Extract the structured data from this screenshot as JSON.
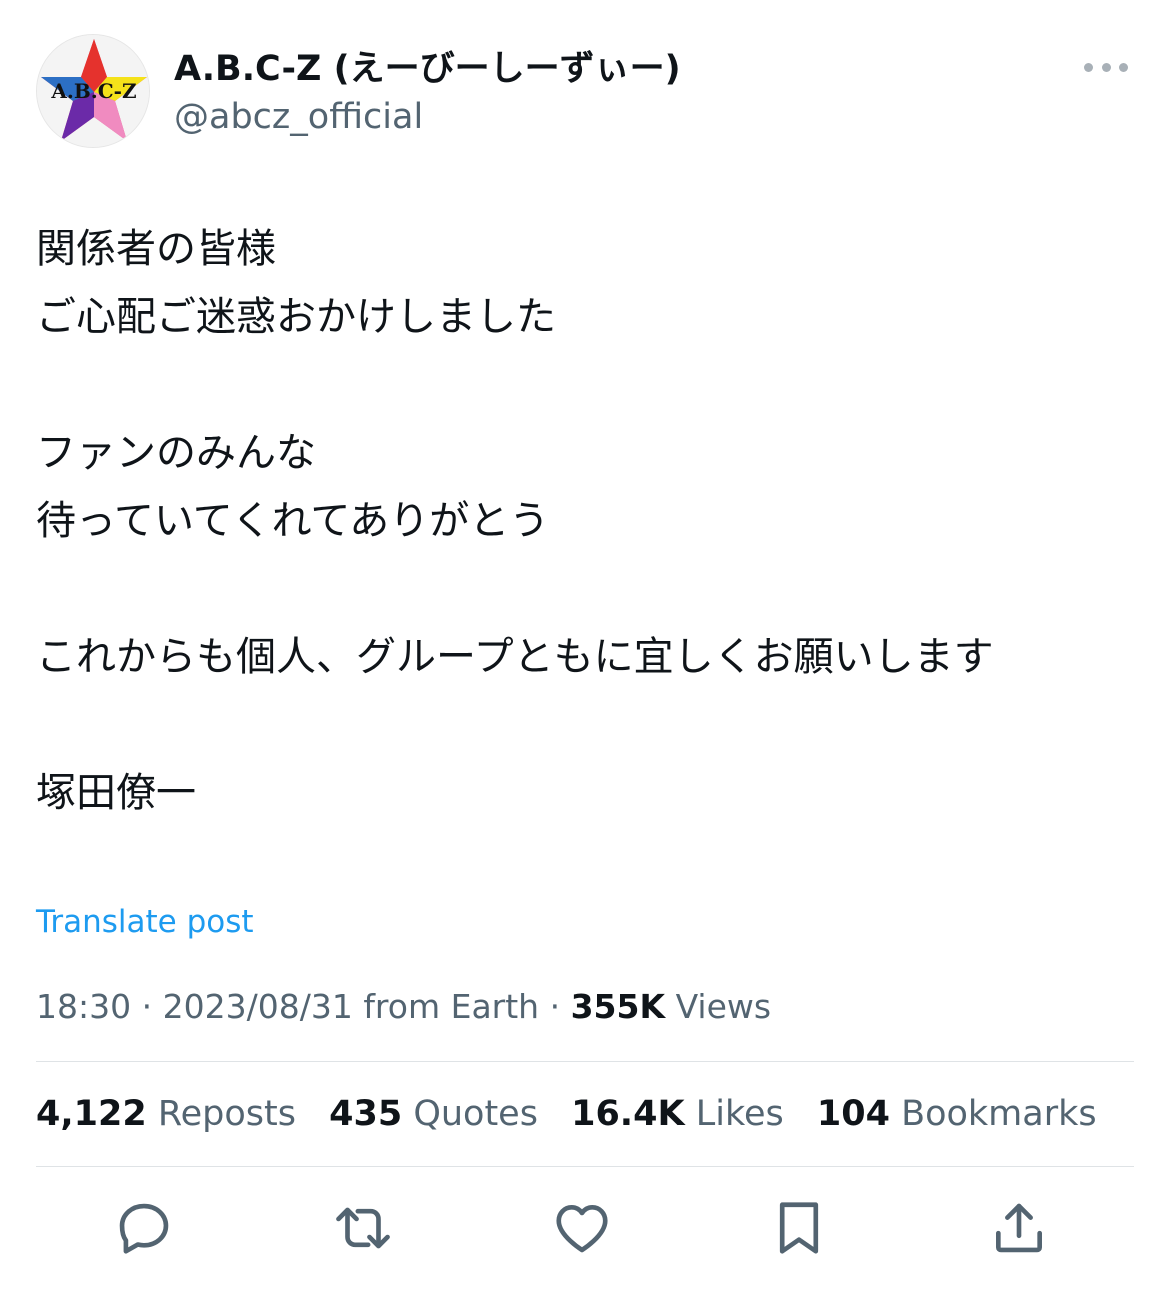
{
  "account": {
    "display_name": "A.B.C-Z (えーびーしーずぃー)",
    "handle": "@abcz_official",
    "avatar_logo_text": "A.B.C-Z"
  },
  "post": {
    "lines": [
      "関係者の皆様",
      "ご心配ご迷惑おかけしました",
      "",
      "ファンのみんな",
      "待っていてくれてありがとう",
      "",
      "これからも個人、グループともに宜しくお願いします",
      "",
      "塚田僚一"
    ],
    "translate_label": "Translate post",
    "time": "18:30",
    "date": "2023/08/31",
    "source": "from Earth",
    "separator": "·",
    "views_count": "355K",
    "views_label": "Views"
  },
  "stats": [
    {
      "count": "4,122",
      "label": "Reposts"
    },
    {
      "count": "435",
      "label": "Quotes"
    },
    {
      "count": "16.4K",
      "label": "Likes"
    },
    {
      "count": "104",
      "label": "Bookmarks"
    }
  ],
  "actions": [
    "reply-icon",
    "repost-icon",
    "like-icon",
    "bookmark-icon",
    "share-icon"
  ],
  "colors": {
    "link": "#1d9bf0",
    "secondary_text": "#536471",
    "primary_text": "#0f1419",
    "icon": "#536471"
  }
}
